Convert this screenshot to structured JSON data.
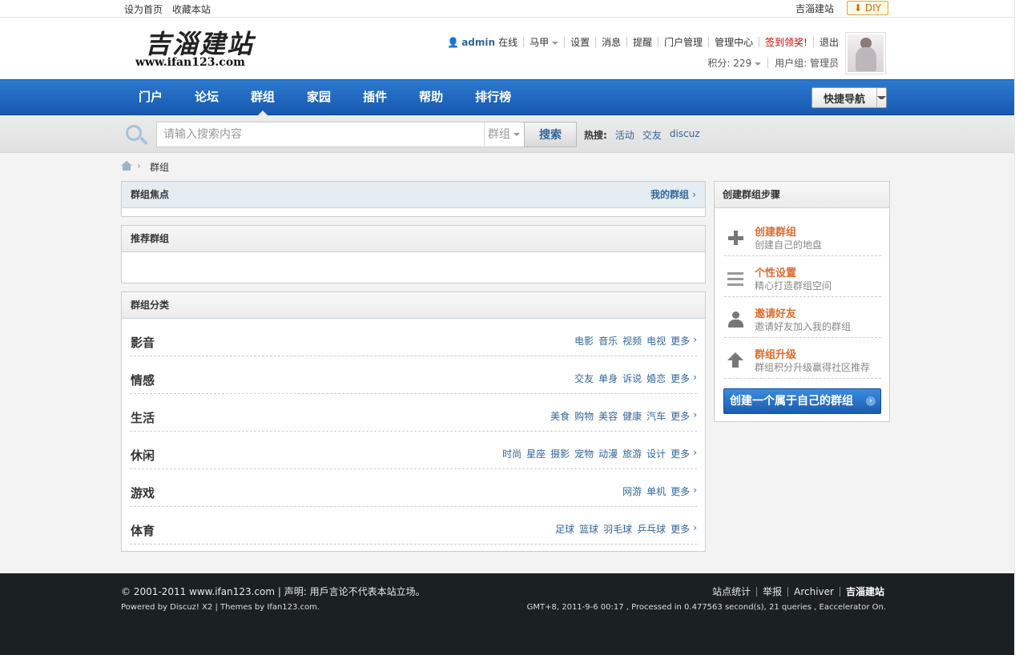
{
  "topbar": {
    "set_home": "设为首页",
    "bookmark": "收藏本站",
    "site_name": "吉淄建站",
    "diy": "DIY"
  },
  "logo": {
    "text_cn": "吉淄建站",
    "text_url": "www.ifan123.com"
  },
  "user_menu": {
    "username": "admin",
    "online": "在线",
    "vest": "马甲",
    "items": [
      "设置",
      "消息",
      "提醒",
      "门户管理",
      "管理中心"
    ],
    "checkin": "签到领奖!",
    "logout": "退出",
    "credits": "积分: 229",
    "usergroup": "用户组: 管理员"
  },
  "nav": {
    "items": [
      "门户",
      "论坛",
      "群组",
      "家园",
      "插件",
      "帮助",
      "排行榜"
    ],
    "active_index": 2,
    "quick_nav": "快捷导航"
  },
  "search": {
    "placeholder": "请输入搜索内容",
    "scope": "群组",
    "button": "搜索",
    "hot_label": "热搜:",
    "hot": [
      "活动",
      "交友",
      "discuz"
    ]
  },
  "breadcrumb": {
    "current": "群组"
  },
  "focus_box": {
    "title": "群组焦点",
    "my_groups": "我的群组"
  },
  "recommend_box": {
    "title": "推荐群组"
  },
  "category_box": {
    "title": "群组分类",
    "categories": [
      {
        "name": "影音",
        "links": [
          "电影",
          "音乐",
          "视频",
          "电视",
          "更多"
        ]
      },
      {
        "name": "情感",
        "links": [
          "交友",
          "单身",
          "诉说",
          "婚恋",
          "更多"
        ]
      },
      {
        "name": "生活",
        "links": [
          "美食",
          "购物",
          "美容",
          "健康",
          "汽车",
          "更多"
        ]
      },
      {
        "name": "休闲",
        "links": [
          "时尚",
          "星座",
          "摄影",
          "宠物",
          "动漫",
          "旅游",
          "设计",
          "更多"
        ]
      },
      {
        "name": "游戏",
        "links": [
          "网游",
          "单机",
          "更多"
        ]
      },
      {
        "name": "体育",
        "links": [
          "足球",
          "篮球",
          "羽毛球",
          "乒乓球",
          "更多"
        ]
      }
    ]
  },
  "side": {
    "title": "创建群组步骤",
    "steps": [
      {
        "title": "创建群组",
        "desc": "创建自己的地盘",
        "icon": "plus-icon"
      },
      {
        "title": "个性设置",
        "desc": "精心打造群组空间",
        "icon": "list-icon"
      },
      {
        "title": "邀请好友",
        "desc": "邀请好友加入我的群组",
        "icon": "user-icon"
      },
      {
        "title": "群组升级",
        "desc": "群组积分升级赢得社区推荐",
        "icon": "arrow-up-icon"
      }
    ],
    "create_button": "创建一个属于自己的群组"
  },
  "footer": {
    "copyright": "© 2001-2011 www.ifan123.com | 声明: 用戶言论不代表本站立场。",
    "powered": "Powered by Discuz! X2 | Themes by Ifan123.com.",
    "links": [
      "站点统计",
      "举报",
      "Archiver",
      "吉淄建站"
    ],
    "stats": "GMT+8, 2011-9-6 00:17 , Processed in 0.477563 second(s), 21 queries , Eaccelerator On."
  }
}
